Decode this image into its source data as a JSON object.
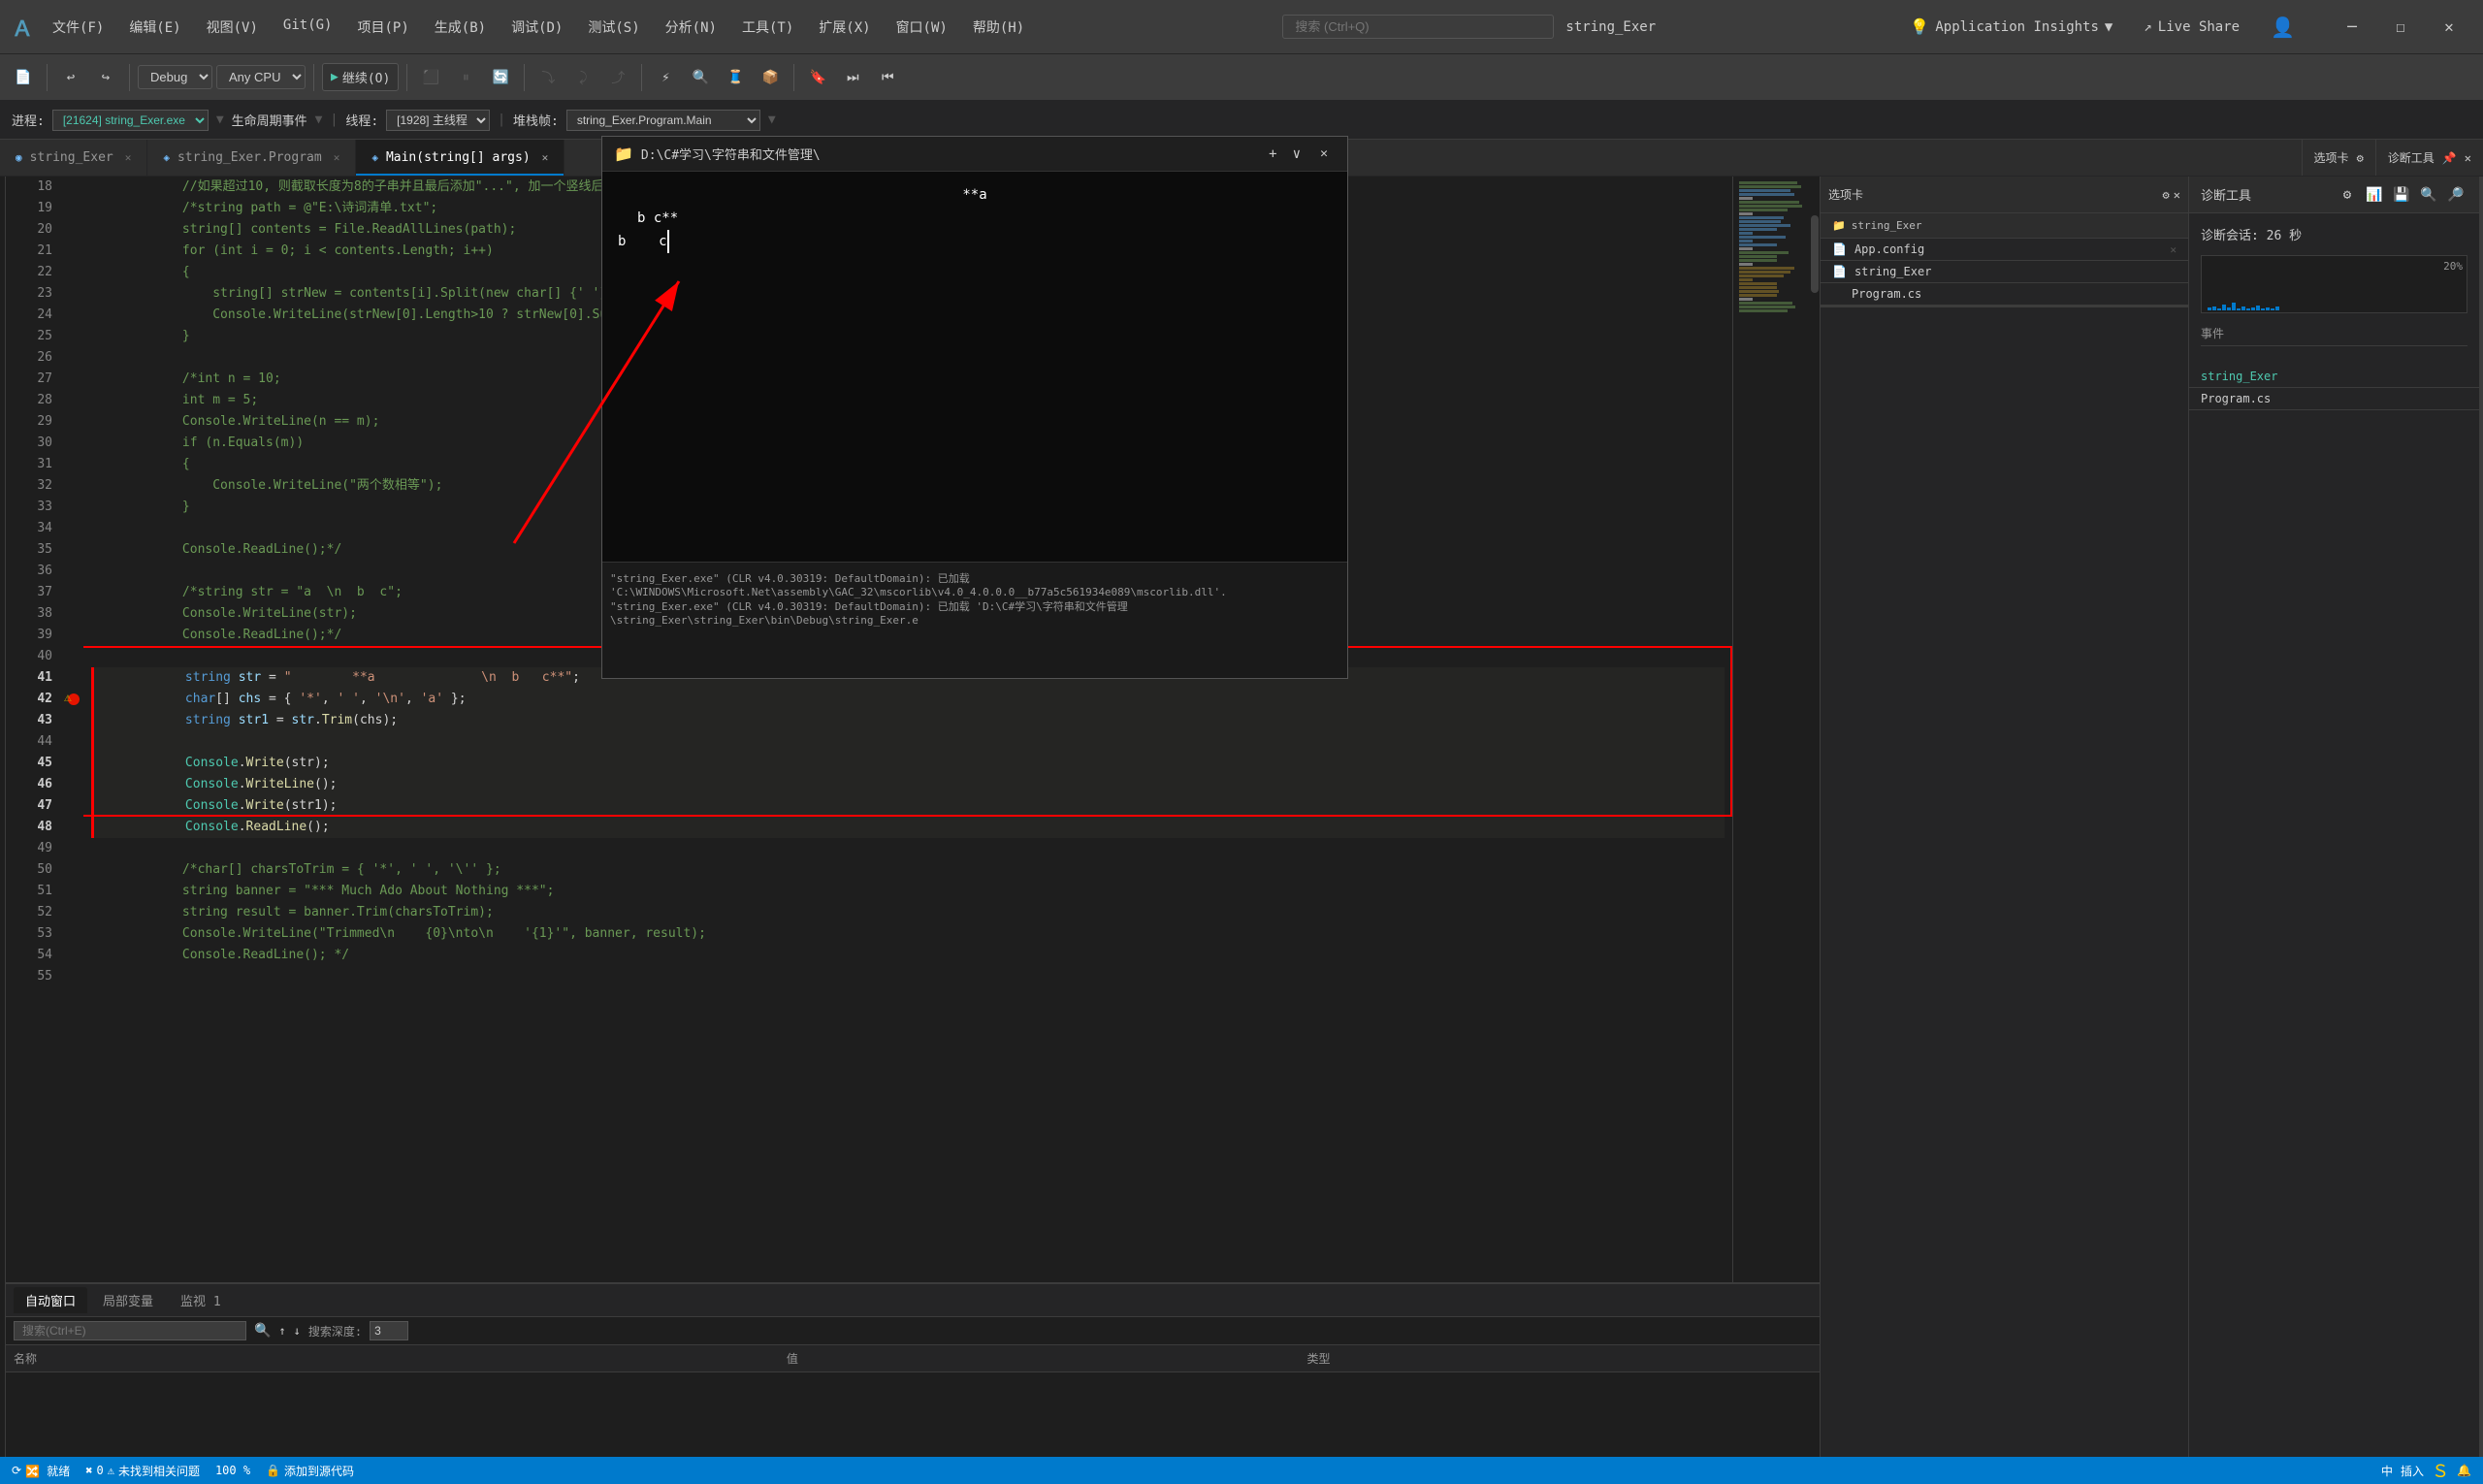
{
  "titleBar": {
    "logo": "Ａ",
    "menuItems": [
      "文件(F)",
      "编辑(E)",
      "视图(V)",
      "Git(G)",
      "项目(P)",
      "生成(B)",
      "调试(D)",
      "测试(S)",
      "分析(N)",
      "工具(T)",
      "扩展(X)",
      "窗口(W)",
      "帮助(H)"
    ],
    "searchPlaceholder": "搜索 (Ctrl+Q)",
    "appName": "string_Exer",
    "appInsights": "Application Insights",
    "liveShare": "Live Share",
    "windowControls": [
      "─",
      "☐",
      "✕"
    ]
  },
  "toolbar": {
    "undoLabel": "↩",
    "debugMode": "Debug",
    "platform": "Any CPU",
    "continueLabel": "▶ 继续(O)",
    "stopLabel": "⬛"
  },
  "debugBar": {
    "processLabel": "进程:",
    "processValue": "[21624] string_Exer.exe",
    "lifetimeLabel": "生命周期事件",
    "threadLabel": "线程:",
    "threadValue": "[1928] 主线程",
    "stackLabel": "堆栈帧:",
    "stackValue": "string_Exer.Program.Main"
  },
  "tabs": [
    {
      "id": "string_exer",
      "label": "string_Exer",
      "icon": "◉",
      "active": false
    },
    {
      "id": "string_program",
      "label": "string_Exer.Program",
      "icon": "◈",
      "active": false
    },
    {
      "id": "main_method",
      "label": "Main(string[] args)",
      "icon": "◈",
      "active": true
    }
  ],
  "codeLines": [
    {
      "num": 18,
      "content": "            //如果超过10, 则截取长度为8的子串并且最后添加\"...\", 加一个竖线后输出作者的名字.",
      "type": "comment"
    },
    {
      "num": 19,
      "content": "            /*string path = @\"E:\\诗词清单.txt\";",
      "type": "comment"
    },
    {
      "num": 20,
      "content": "            string[] contents = File.ReadAllLines(path);",
      "type": "code"
    },
    {
      "num": 21,
      "content": "            for (int i = 0; i < contents.Length; i++)",
      "type": "code"
    },
    {
      "num": 22,
      "content": "            {",
      "type": "code"
    },
    {
      "num": 23,
      "content": "                string[] strNew = contents[i].Split(new char[] {' '}, StringSplitOptions.Remove",
      "type": "code"
    },
    {
      "num": 24,
      "content": "                Console.WriteLine(strNew[0].Length>10 ? strNew[0].Substring(0,8) + \"...\" :",
      "type": "code"
    },
    {
      "num": 25,
      "content": "            }",
      "type": "code"
    },
    {
      "num": 26,
      "content": "",
      "type": "blank"
    },
    {
      "num": 27,
      "content": "            /*int n = 10;",
      "type": "comment"
    },
    {
      "num": 28,
      "content": "            int m = 5;",
      "type": "comment"
    },
    {
      "num": 29,
      "content": "            Console.WriteLine(n == m);",
      "type": "comment"
    },
    {
      "num": 30,
      "content": "            if (n.Equals(m))",
      "type": "comment"
    },
    {
      "num": 31,
      "content": "            {",
      "type": "comment"
    },
    {
      "num": 32,
      "content": "                Console.WriteLine(\"两个数相等\");",
      "type": "comment"
    },
    {
      "num": 33,
      "content": "            }",
      "type": "comment"
    },
    {
      "num": 34,
      "content": "",
      "type": "blank"
    },
    {
      "num": 35,
      "content": "            Console.ReadLine();*/",
      "type": "comment"
    },
    {
      "num": 36,
      "content": "",
      "type": "blank"
    },
    {
      "num": 37,
      "content": "            /*string str = \"a  \\n  b  c\";",
      "type": "comment"
    },
    {
      "num": 38,
      "content": "            Console.WriteLine(str);",
      "type": "comment"
    },
    {
      "num": 39,
      "content": "            Console.ReadLine();*/",
      "type": "comment"
    },
    {
      "num": 40,
      "content": "",
      "type": "blank"
    },
    {
      "num": 41,
      "highlight": true,
      "content": "            string str = \"        **a              \\n  b   c**\";",
      "type": "code-highlight"
    },
    {
      "num": 42,
      "highlight": true,
      "breakpoint": true,
      "content": "            char[] chs = { '*', ' ', '\\n', 'a' };",
      "type": "code-highlight"
    },
    {
      "num": 43,
      "highlight": true,
      "content": "            string str1 = str.Trim(chs);",
      "type": "code-highlight"
    },
    {
      "num": 44,
      "highlight": true,
      "content": "",
      "type": "blank-highlight"
    },
    {
      "num": 45,
      "highlight": true,
      "content": "            Console.Write(str);",
      "type": "code-highlight"
    },
    {
      "num": 46,
      "highlight": true,
      "content": "            Console.WriteLine();",
      "type": "code-highlight"
    },
    {
      "num": 47,
      "highlight": true,
      "content": "            Console.Write(str1);",
      "type": "code-highlight"
    },
    {
      "num": 48,
      "highlight": true,
      "content": "            Console.ReadLine();",
      "type": "code-highlight"
    },
    {
      "num": 49,
      "content": "",
      "type": "blank"
    },
    {
      "num": 50,
      "content": "            /*char[] charsToTrim = { '*', ' ', '\\'' };",
      "type": "comment"
    },
    {
      "num": 51,
      "content": "            string banner = \"*** Much Ado About Nothing ***\";",
      "type": "comment"
    },
    {
      "num": 52,
      "content": "            string result = banner.Trim(charsToTrim);",
      "type": "comment"
    },
    {
      "num": 53,
      "content": "            Console.WriteLine(\"Trimmed\\n    {0}\\nto\\n    '{1}'\", banner, result);",
      "type": "comment"
    },
    {
      "num": 54,
      "content": "            Console.ReadLine(); */",
      "type": "comment"
    },
    {
      "num": 55,
      "content": "",
      "type": "blank"
    }
  ],
  "console": {
    "title": "D:\\C#学习\\字符串和文件管理\\",
    "output1": "**a",
    "output2": "b  c**",
    "output3": "b   c",
    "logLine1": "\"string_Exer.exe\" (CLR v4.0.30319: DefaultDomain): 已加载 'C:\\WINDOWS\\Microsoft.Net\\assembly\\GAC_32\\mscorlib\\v4.0_4.0.0.0__b77a5c561934e089\\mscorlib.dll'.",
    "logLine2": "\"string_Exer.exe\" (CLR v4.0.30319: DefaultDomain): 已加载 'D:\\C#学习\\字符串和文件管理\\string_Exer\\string_Exer\\bin\\Debug\\string_Exer.e"
  },
  "rightPanel": {
    "title": "选项卡",
    "items": [
      {
        "label": "string_Exer",
        "sub": "App.config",
        "icon": "📄"
      },
      {
        "label": "string_Exer",
        "sub": "Program.cs",
        "icon": "📄"
      }
    ]
  },
  "diagPanel": {
    "title": "诊断工具",
    "timer": "诊断会话: 26 秒",
    "progress": 30,
    "eventLabel": "事件",
    "section1": "string_Exer",
    "section2": "Program.cs"
  },
  "statusBar": {
    "gitBranch": "🔀 就绪",
    "errorCount": "0",
    "warningCount": "未找到相关问题",
    "zoom": "100 %",
    "encoding": "添加到源代码",
    "lineCol": "中",
    "insertMode": "插入"
  },
  "bottomPanel": {
    "tabs": [
      "自动窗口",
      "局部变量",
      "监视 1"
    ],
    "activeTab": "自动窗口",
    "searchPlaceholder": "搜索(Ctrl+E)",
    "searchDepthLabel": "搜索深度:",
    "searchDepthValue": "3",
    "columns": [
      "名称",
      "值",
      "类型"
    ]
  }
}
